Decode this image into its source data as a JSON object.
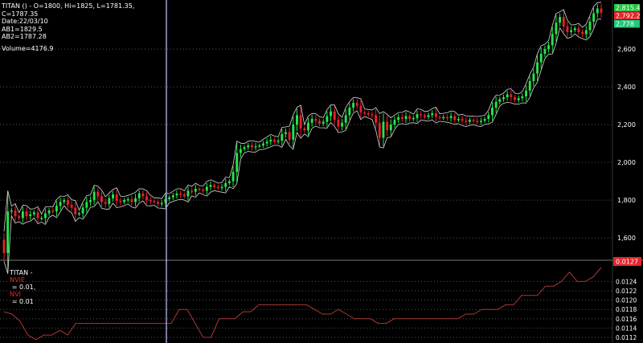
{
  "chart_data": [
    {
      "type": "candlestick",
      "ticker": "TITAN",
      "header": {
        "ohlc_line": "TITAN () - O=1800, Hi=1825, L=1781.35,",
        "close_line": "C=1787.35",
        "date_line": "Date:22/03/10",
        "ab1_line": "AB1=1829.5",
        "ab2_line": "AB2=1787.28",
        "volume_line": "Volume=4176.9"
      },
      "y_ticks": [
        "1,600",
        "1,800",
        "2,000",
        "2,200",
        "2,400",
        "2,600"
      ],
      "ylim": [
        1490,
        2860
      ],
      "price_tags": [
        {
          "label": "2,815.4",
          "color": "#25c441"
        },
        {
          "label": "2,792.2",
          "color": "#e3262c"
        },
        {
          "label": "2,778",
          "color": "#21c97b"
        }
      ],
      "closes": [
        1520,
        1740,
        1745,
        1715,
        1705,
        1740,
        1715,
        1725,
        1735,
        1705,
        1705,
        1730,
        1745,
        1740,
        1770,
        1790,
        1800,
        1775,
        1760,
        1725,
        1730,
        1760,
        1790,
        1800,
        1845,
        1820,
        1790,
        1780,
        1810,
        1830,
        1795,
        1790,
        1800,
        1805,
        1790,
        1810,
        1835,
        1820,
        1800,
        1795,
        1790,
        1780,
        1785,
        1805,
        1815,
        1825,
        1835,
        1830,
        1820,
        1850,
        1845,
        1860,
        1855,
        1850,
        1870,
        1880,
        1870,
        1865,
        1870,
        1890,
        1900,
        1950,
        2050,
        2070,
        2080,
        2090,
        2080,
        2085,
        2090,
        2100,
        2110,
        2120,
        2110,
        2115,
        2150,
        2160,
        2120,
        2200,
        2250,
        2180,
        2170,
        2210,
        2230,
        2220,
        2205,
        2215,
        2245,
        2270,
        2225,
        2190,
        2210,
        2250,
        2290,
        2315,
        2300,
        2265,
        2260,
        2255,
        2250,
        2210,
        2130,
        2215,
        2170,
        2200,
        2225,
        2240,
        2230,
        2245,
        2230,
        2235,
        2255,
        2250,
        2240,
        2250,
        2260,
        2240,
        2235,
        2240,
        2235,
        2245,
        2225,
        2230,
        2220,
        2215,
        2225,
        2220,
        2215,
        2220,
        2230,
        2250,
        2290,
        2320,
        2335,
        2345,
        2360,
        2345,
        2330,
        2340,
        2350,
        2380,
        2430,
        2470,
        2530,
        2575,
        2600,
        2620,
        2680,
        2740,
        2770,
        2720,
        2690,
        2700,
        2710,
        2690,
        2680,
        2700,
        2745,
        2790,
        2815,
        2792
      ]
    },
    {
      "type": "line",
      "ticker": "TITAN",
      "title_parts": [
        "TITAN - ",
        "NVIE",
        " = 0.01, ",
        "NVI",
        " = 0.01"
      ],
      "y_ticks": [
        "0.0124",
        "0.0122",
        "0.0120",
        "0.0118",
        "0.0116",
        "0.0114",
        "0.0112"
      ],
      "ylim": [
        0.01108,
        0.0127
      ],
      "last_value_tag": {
        "label": "0.0127",
        "color": "#e3262c"
      },
      "values": [
        0.01175,
        0.0117,
        0.01155,
        0.01125,
        0.01115,
        0.01125,
        0.01125,
        0.01135,
        0.01125,
        0.0115,
        0.0115,
        0.0115,
        0.0115,
        0.0115,
        0.0115,
        0.0115,
        0.0115,
        0.0115,
        0.0115,
        0.0115,
        0.0115,
        0.0115,
        0.0118,
        0.0118,
        0.0115,
        0.0112,
        0.0112,
        0.0116,
        0.0116,
        0.0116,
        0.01175,
        0.01175,
        0.0119,
        0.0119,
        0.0119,
        0.0119,
        0.0119,
        0.0119,
        0.0119,
        0.0118,
        0.0117,
        0.0117,
        0.0118,
        0.0117,
        0.0116,
        0.0116,
        0.0116,
        0.0115,
        0.0115,
        0.0116,
        0.0116,
        0.0116,
        0.0116,
        0.0116,
        0.0116,
        0.0116,
        0.0116,
        0.0116,
        0.0117,
        0.0117,
        0.0118,
        0.0118,
        0.0118,
        0.0119,
        0.0119,
        0.0121,
        0.0121,
        0.0121,
        0.0123,
        0.0123,
        0.0124,
        0.0126,
        0.0124,
        0.0124,
        0.0125,
        0.0127
      ]
    }
  ],
  "colors": {
    "bull": "#25e64a",
    "bear": "#e8202c",
    "envelope": "#d8d8d8",
    "indicator_line": "#a83a32",
    "cursor": "#c8c8ff",
    "grid": "#555555",
    "separator": "#7a7a7a"
  }
}
